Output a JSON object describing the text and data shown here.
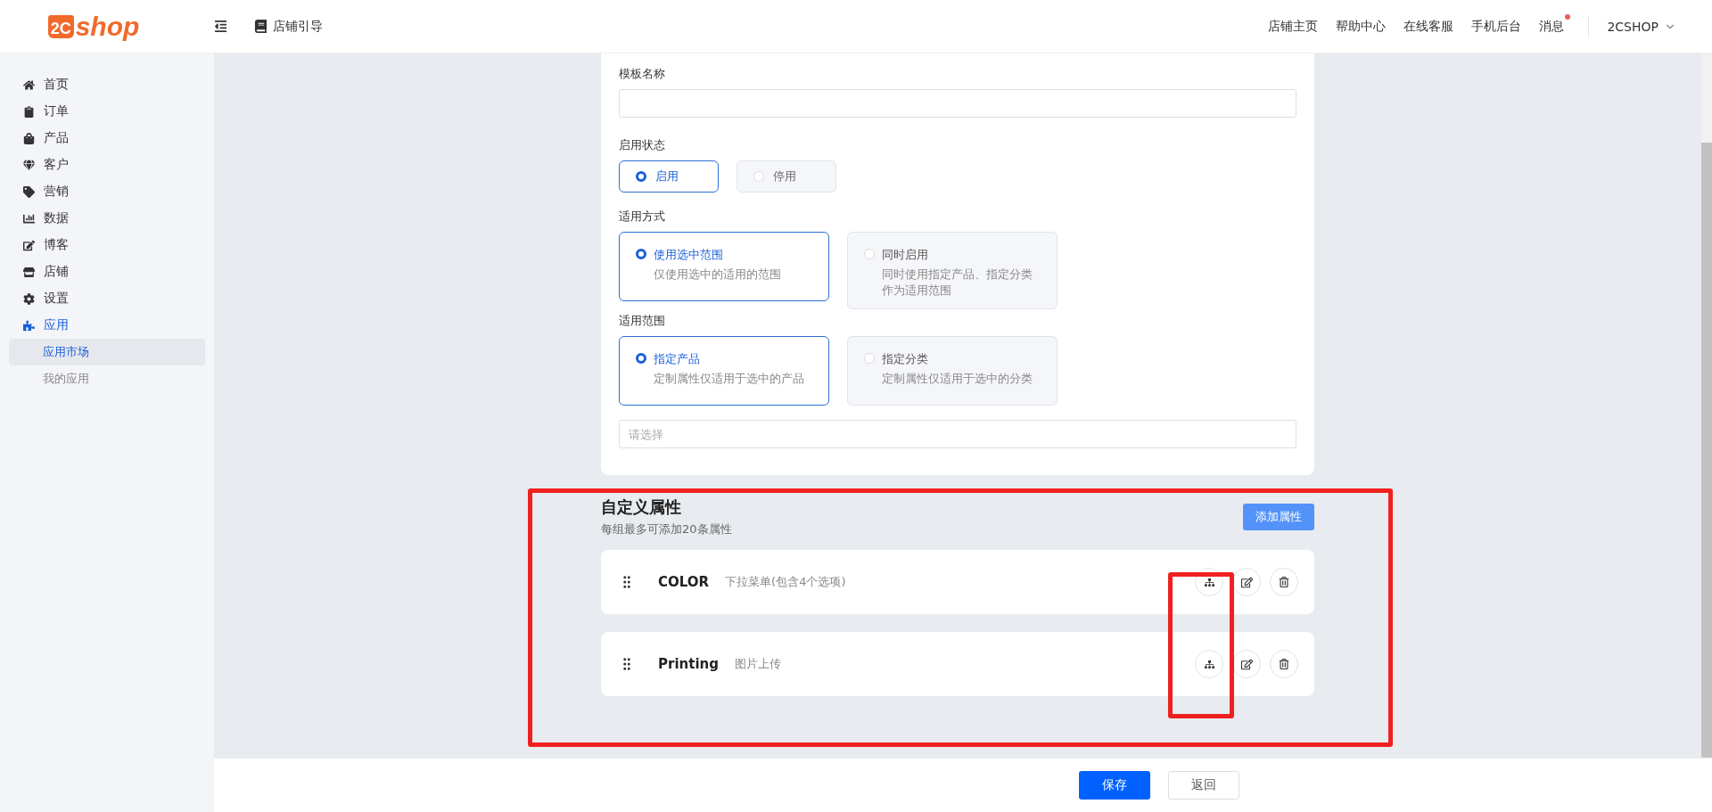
{
  "header": {
    "logo": {
      "mark": "2C",
      "word": "shop"
    },
    "guide": "店铺引导",
    "links": [
      "店铺主页",
      "帮助中心",
      "在线客服",
      "手机后台"
    ],
    "messages": {
      "label": "消息",
      "unread": true
    },
    "account": "2CSHOP"
  },
  "sidebar": {
    "items": [
      {
        "label": "首页",
        "selected": false
      },
      {
        "label": "订单",
        "selected": false
      },
      {
        "label": "产品",
        "selected": false
      },
      {
        "label": "客户",
        "selected": false
      },
      {
        "label": "营销",
        "selected": false
      },
      {
        "label": "数据",
        "selected": false
      },
      {
        "label": "博客",
        "selected": false
      },
      {
        "label": "店铺",
        "selected": false
      },
      {
        "label": "设置",
        "selected": false
      },
      {
        "label": "应用",
        "selected": true,
        "expanded": true,
        "children": [
          {
            "label": "应用市场",
            "selected": true
          },
          {
            "label": "我的应用",
            "selected": false
          }
        ]
      }
    ]
  },
  "form": {
    "template_name": {
      "label": "模板名称"
    },
    "status": {
      "label": "启用状态",
      "options": [
        {
          "label": "启用",
          "selected": true
        },
        {
          "label": "停用",
          "selected": false
        }
      ]
    },
    "mode": {
      "label": "适用方式",
      "options": [
        {
          "title": "使用选中范围",
          "description": "仅使用选中的适用的范围",
          "selected": true
        },
        {
          "title": "同时启用",
          "description": "同时使用指定产品、指定分类作为适用范围",
          "selected": false
        }
      ]
    },
    "scope": {
      "label": "适用范围",
      "options": [
        {
          "title": "指定产品",
          "description": "定制属性仅适用于选中的产品",
          "selected": true
        },
        {
          "title": "指定分类",
          "description": "定制属性仅适用于选中的分类",
          "selected": false
        }
      ]
    },
    "scope_select": {
      "placeholder": "请选择"
    }
  },
  "custom_attributes": {
    "title": "自定义属性",
    "subtitle": "每组最多可添加20条属性",
    "add_button": "添加属性",
    "rows": [
      {
        "name": "COLOR",
        "type": "下拉菜单(包含4个选项)"
      },
      {
        "name": "Printing",
        "type": "图片上传"
      }
    ]
  },
  "footer": {
    "save": "保存",
    "back": "返回"
  },
  "annotations": [
    {
      "kind": "outline",
      "color": "#f02020"
    },
    {
      "kind": "outline",
      "color": "#f02020"
    }
  ]
}
